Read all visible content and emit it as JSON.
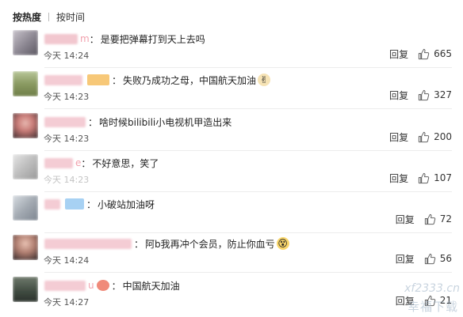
{
  "sort": {
    "hot": "按热度",
    "time": "按时间"
  },
  "reply_label": "回复",
  "comments": [
    {
      "username": "m",
      "text": "是要把弹幕打到天上去吗",
      "time": "今天 14:24",
      "likes": "665"
    },
    {
      "username": "",
      "text": "失败乃成功之母，中国航天加油",
      "emoji": "✌",
      "time": "今天 14:23",
      "likes": "327"
    },
    {
      "username": "",
      "text": "啥时候bilibili小电视机甲造出来",
      "time": "今天 14:23",
      "likes": "200"
    },
    {
      "username": "e",
      "text": "不好意思，笑了",
      "time": "今天 14:23",
      "likes": "107"
    },
    {
      "username": "",
      "text": "小破站加油呀",
      "time": "",
      "likes": "72"
    },
    {
      "username": "",
      "text": "阿b我再冲个会员，防止你血亏",
      "emoji": "😵",
      "time": "今天 14:24",
      "likes": "56"
    },
    {
      "username": "u",
      "text": "中国航天加油",
      "time": "今天 14:27",
      "likes": "21"
    }
  ],
  "watermark": {
    "url": "xf2333.cn",
    "name": "幸福下载"
  }
}
